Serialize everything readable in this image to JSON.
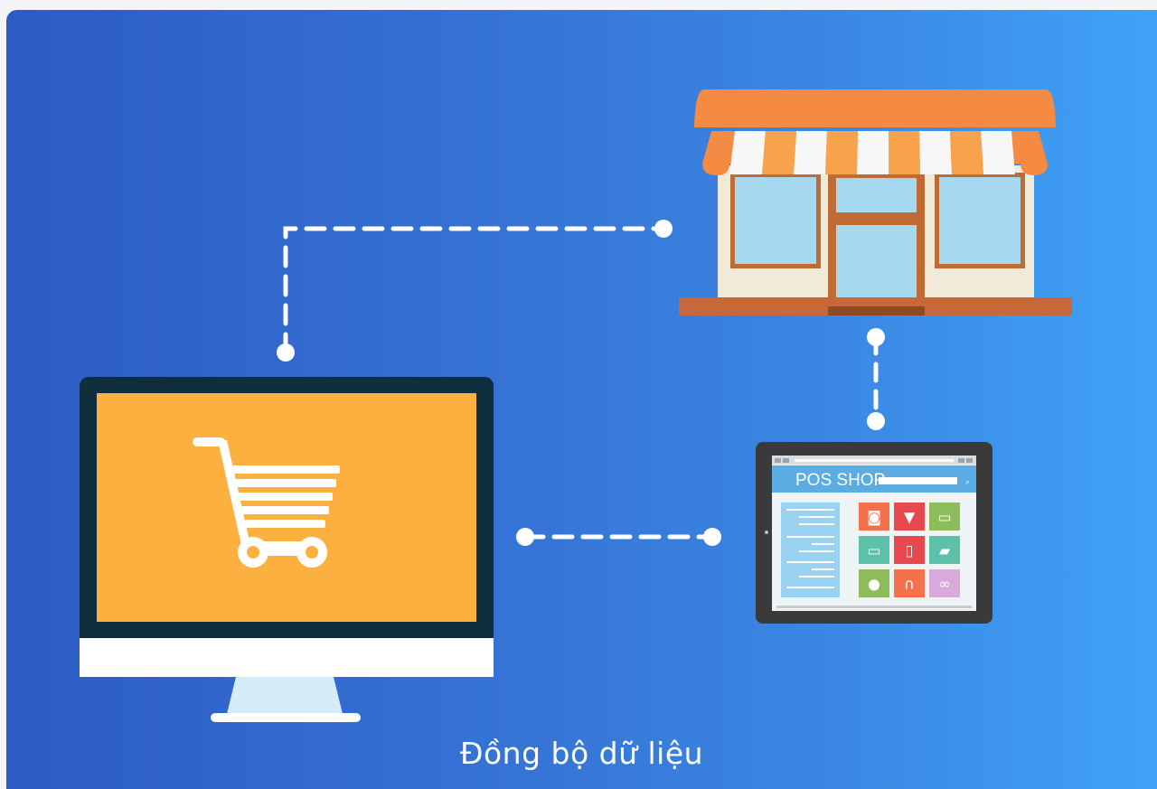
{
  "caption": "Đồng bộ dữ liệu",
  "tablet": {
    "app_title": "POS SHOP",
    "tiles": [
      {
        "icon": "camera-icon",
        "color": "#f3724d"
      },
      {
        "icon": "tshirt-icon",
        "color": "#e8494f"
      },
      {
        "icon": "laptop-icon",
        "color": "#8cbd5a"
      },
      {
        "icon": "monitor-icon",
        "color": "#5cc1a8"
      },
      {
        "icon": "phone-icon",
        "color": "#e8494f"
      },
      {
        "icon": "shoe-icon",
        "color": "#5cc1a8"
      },
      {
        "icon": "gamepad-icon",
        "color": "#8cbd5a"
      },
      {
        "icon": "headphones-icon",
        "color": "#f3724d"
      },
      {
        "icon": "glasses-icon",
        "color": "#d9a9dc"
      }
    ]
  },
  "computer": {
    "screen_icon": "shopping-cart-icon",
    "screen_color": "#fbb040"
  },
  "store": {
    "awning_color": "#f58b43"
  },
  "colors": {
    "connector": "#ffffff"
  }
}
